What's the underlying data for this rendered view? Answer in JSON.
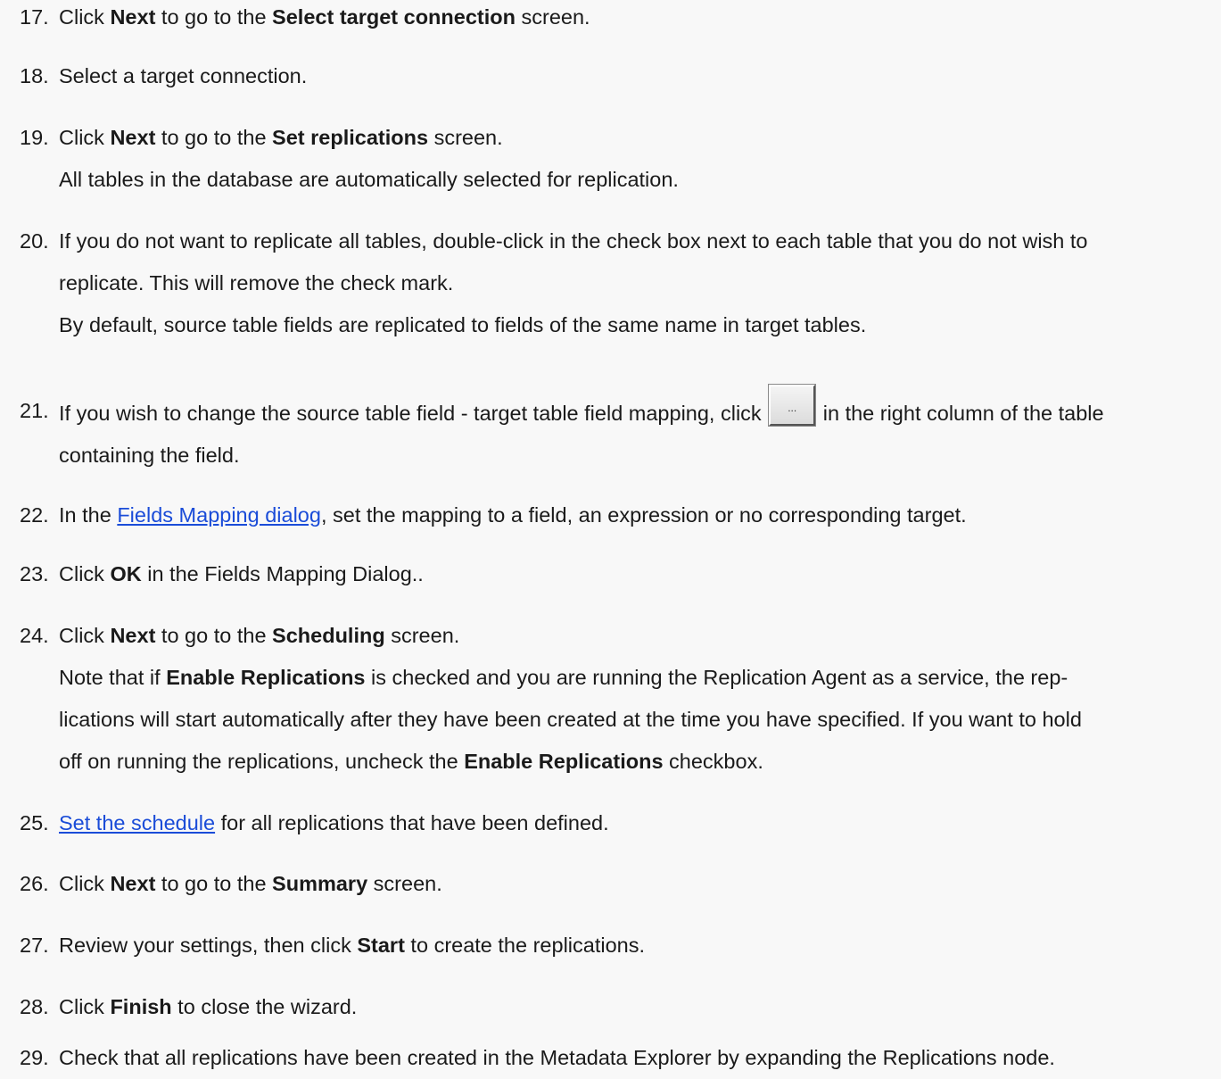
{
  "steps": [
    {
      "num": "17.",
      "parts": [
        "Click ",
        "Next",
        " to go to the ",
        "Select target connection",
        " screen."
      ]
    },
    {
      "num": "18.",
      "text": "Select a target connection."
    },
    {
      "num": "19.",
      "parts": [
        "Click ",
        "Next",
        " to go to the ",
        "Set replications",
        " screen."
      ],
      "note": "All tables in the database are automatically selected for replication."
    },
    {
      "num": "20.",
      "line1": "If you do not want to replicate all tables, double-click in the check box next to each table that you do not wish to",
      "line2": "replicate. This will remove the check mark.",
      "note": "By default, source table fields are replicated to fields of the same name in target tables."
    },
    {
      "num": "21.",
      "before": "If you wish to change the source table field - target table field mapping, click",
      "button_label": "...",
      "after": " in the right column of the table",
      "line2": "containing the field."
    },
    {
      "num": "22.",
      "before": "In the ",
      "link": "Fields Mapping dialog",
      "after": ", set the mapping to a field, an expression or no corresponding target."
    },
    {
      "num": "23.",
      "parts": [
        "Click ",
        "OK",
        " in the Fields Mapping Dialog.."
      ]
    },
    {
      "num": "24.",
      "parts": [
        "Click ",
        "Next",
        " to go to the ",
        "Scheduling",
        " screen."
      ],
      "note": {
        "a": "Note that if ",
        "b": "Enable Replications",
        "c": " is checked and you are running the Replication Agent as a service, the rep-",
        "d": "lications will start automatically after they have been created at the time you have specified. If you want to hold",
        "e": "off on running the replications, uncheck the ",
        "f": "Enable Replications",
        "g": " checkbox."
      }
    },
    {
      "num": "25.",
      "link": "Set the schedule",
      "after": " for all replications that have been defined."
    },
    {
      "num": "26.",
      "parts": [
        "Click ",
        "Next",
        " to go to the ",
        "Summary",
        " screen."
      ]
    },
    {
      "num": "27.",
      "parts": [
        "Review your settings, then click ",
        "Start",
        " to create the replications."
      ]
    },
    {
      "num": "28.",
      "parts": [
        "Click ",
        "Finish",
        " to close the wizard."
      ]
    },
    {
      "num": "29.",
      "text": "Check that all replications have been created in the Metadata Explorer by expanding the Replications node."
    }
  ]
}
